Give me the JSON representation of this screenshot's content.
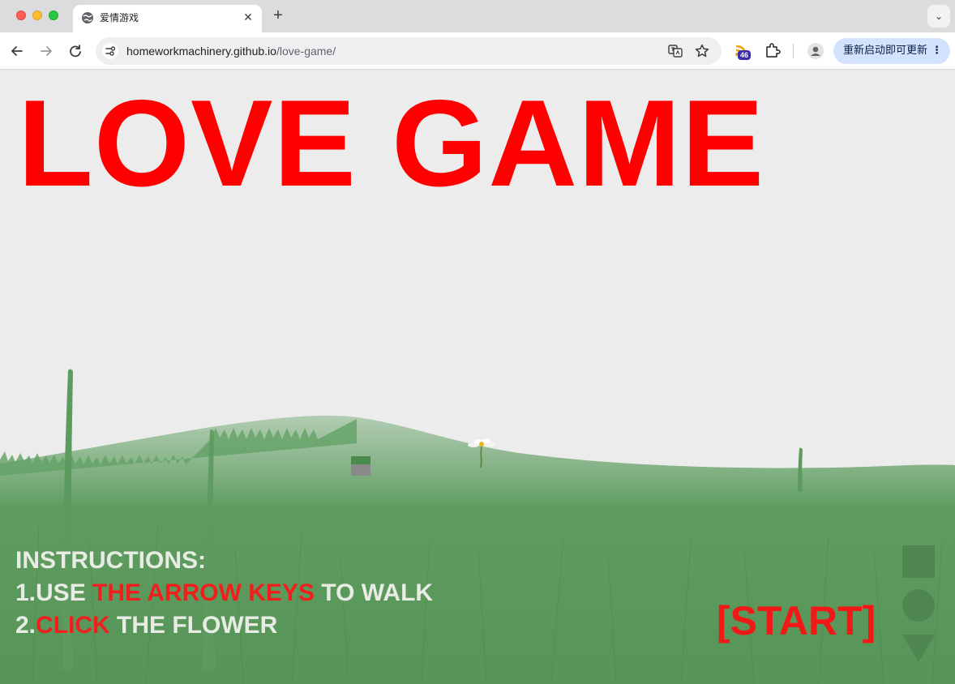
{
  "browser": {
    "tab_title": "爱情游戏",
    "tab_close": "✕",
    "new_tab": "+",
    "tab_menu": "⌄",
    "url_host": "homeworkmachinery.github.io",
    "url_path": "/love-game/",
    "extension_badge": "46",
    "update_button_label": "重新启动即可更新",
    "update_menu": "⋮"
  },
  "game": {
    "title": "LOVE GAME",
    "instructions": {
      "heading": "INSTRUCTIONS:",
      "line1_prefix": "1.USE ",
      "line1_highlight": "THE ARROW KEYS",
      "line1_suffix": " TO WALK",
      "line2_prefix": "2.",
      "line2_highlight": "CLICK",
      "line2_suffix": " THE FLOWER"
    },
    "start_label": "[START]"
  },
  "colors": {
    "title_red": "#ff0000",
    "highlight_red": "#f21e1e",
    "grass_green": "#5c9a5e",
    "control_green": "#4f8550",
    "update_button_bg": "#d3e3fd"
  }
}
